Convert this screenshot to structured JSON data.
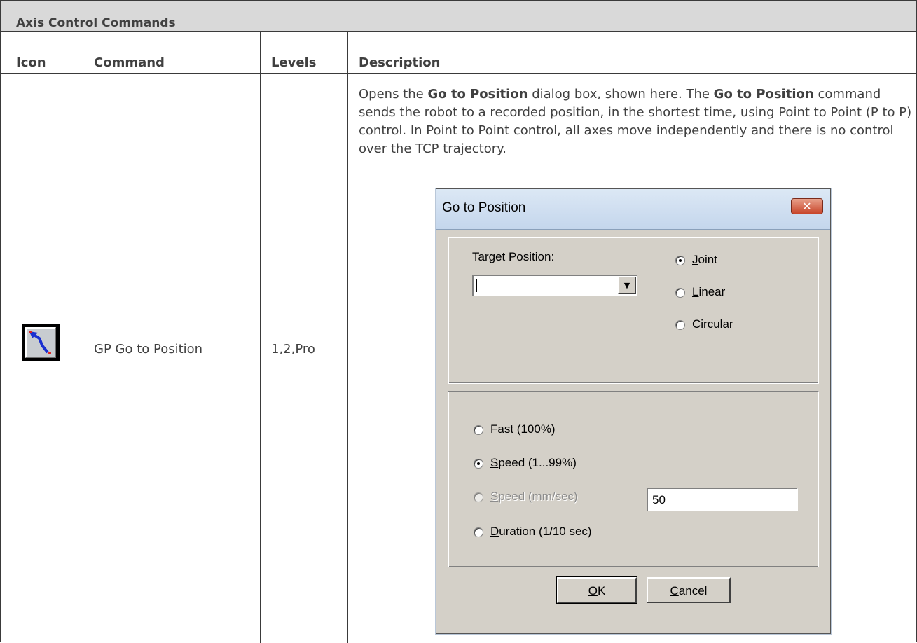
{
  "section": {
    "title": "Axis Control Commands"
  },
  "columns": {
    "icon": "Icon",
    "command": "Command",
    "levels": "Levels",
    "description": "Description"
  },
  "row": {
    "icon_name": "go-to-position-icon",
    "command": "GP Go to Position",
    "levels": "1,2,Pro",
    "description": {
      "p1": "Opens the ",
      "b1": "Go to Position",
      "p2": " dialog box, shown here. The ",
      "b2": "Go to Position",
      "p3": " command sends the robot to a recorded position, in the shortest time, using Point to Point (P to P) control. In Point to Point control, all axes move independently and there is no control over the TCP trajectory."
    }
  },
  "dialog": {
    "title": "Go to Position",
    "close_glyph": "✕",
    "target_label": "Target Position:",
    "target_value": "",
    "dropdown_glyph": "▼",
    "motion": [
      {
        "hot": "J",
        "rest": "oint",
        "selected": true
      },
      {
        "hot": "L",
        "rest": "inear",
        "selected": false
      },
      {
        "hot": "C",
        "rest": "ircular",
        "selected": false
      }
    ],
    "speed": [
      {
        "hot": "F",
        "rest": "ast (100%)",
        "selected": false,
        "enabled": true
      },
      {
        "hot": "S",
        "rest": "peed (1...99%)",
        "selected": true,
        "enabled": true
      },
      {
        "hot": "S",
        "rest": "peed (mm/sec)",
        "selected": false,
        "enabled": false
      },
      {
        "hot": "D",
        "rest": "uration (1/10 sec)",
        "selected": false,
        "enabled": true
      }
    ],
    "speed_value": "50",
    "ok": {
      "hot": "O",
      "rest": "K"
    },
    "cancel": {
      "hot": "C",
      "rest": "ancel"
    }
  }
}
